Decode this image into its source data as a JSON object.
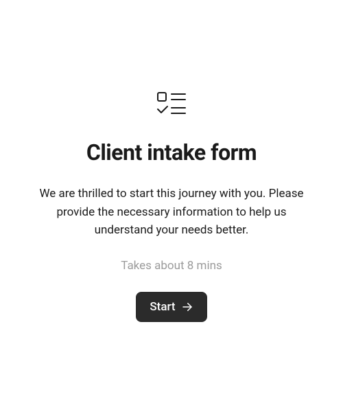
{
  "icon": "todo-list-icon",
  "title": "Client intake form",
  "description": "We are thrilled to start this journey with you. Please provide the necessary information to help us understand your needs better.",
  "duration_text": "Takes about 8 mins",
  "start_button": {
    "label": "Start",
    "icon": "arrow-right-icon"
  }
}
